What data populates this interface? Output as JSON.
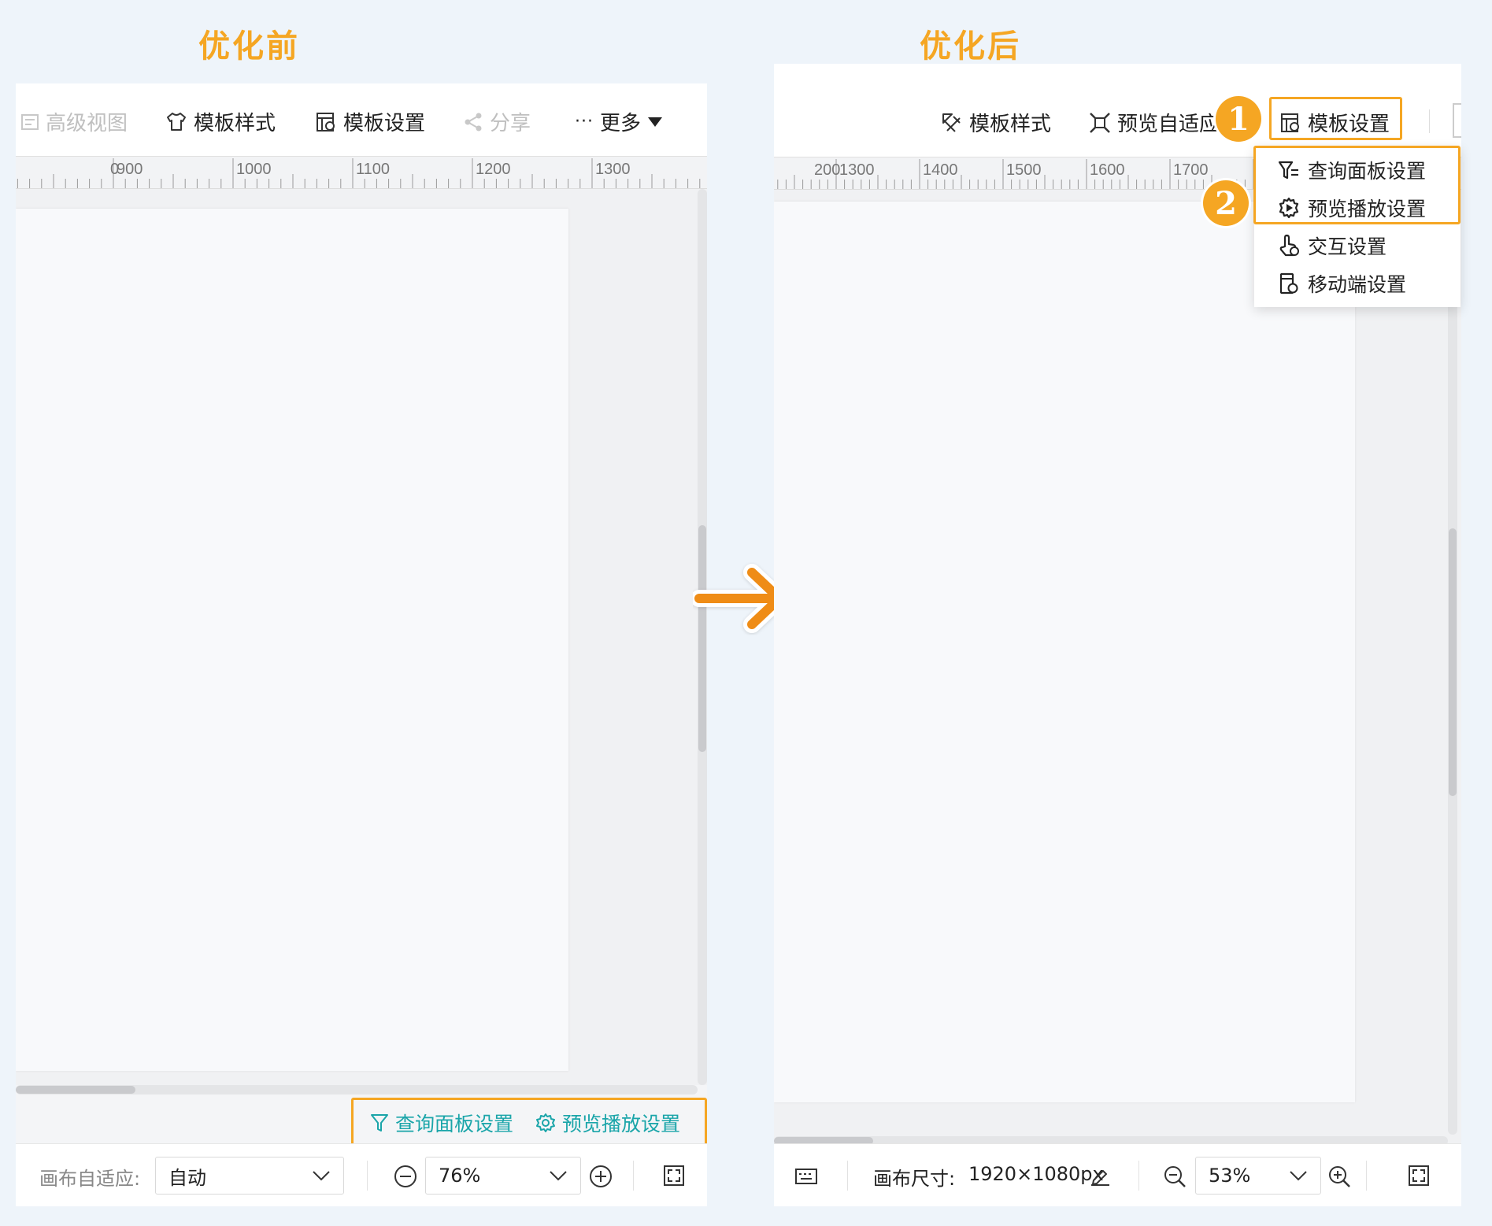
{
  "headings": {
    "before": "优化前",
    "after": "优化后"
  },
  "before": {
    "toolbar": {
      "advanced_view": "高级视图",
      "template_style": "模板样式",
      "template_settings": "模板设置",
      "share": "分享",
      "more": "更多"
    },
    "ruler_labels": [
      "0",
      "900",
      "1000",
      "1100",
      "1200",
      "1300"
    ],
    "bottom_bar": {
      "query_panel": "查询面板设置",
      "preview_play": "预览播放设置"
    },
    "footer": {
      "canvas_adapt_label": "画布自适应:",
      "canvas_adapt_value": "自动",
      "zoom_value": "76%"
    }
  },
  "after": {
    "toolbar": {
      "template_style": "模板样式",
      "preview_adapt": "预览自适应",
      "template_settings": "模板设置"
    },
    "ruler_labels": [
      "200",
      "1300",
      "1400",
      "1500",
      "1600",
      "1700"
    ],
    "badges": [
      "1",
      "2"
    ],
    "dropdown": [
      {
        "label": "查询面板设置",
        "icon": "filter-settings-icon"
      },
      {
        "label": "预览播放设置",
        "icon": "play-settings-icon"
      },
      {
        "label": "交互设置",
        "icon": "interaction-icon"
      },
      {
        "label": "移动端设置",
        "icon": "mobile-settings-icon"
      }
    ],
    "footer": {
      "canvas_size_label": "画布尺寸:",
      "canvas_size_value": "1920×1080px",
      "zoom_value": "53%"
    }
  },
  "colors": {
    "accent": "#f5a623",
    "teal": "#1aa5a9",
    "arrow": "#ef8c12"
  }
}
